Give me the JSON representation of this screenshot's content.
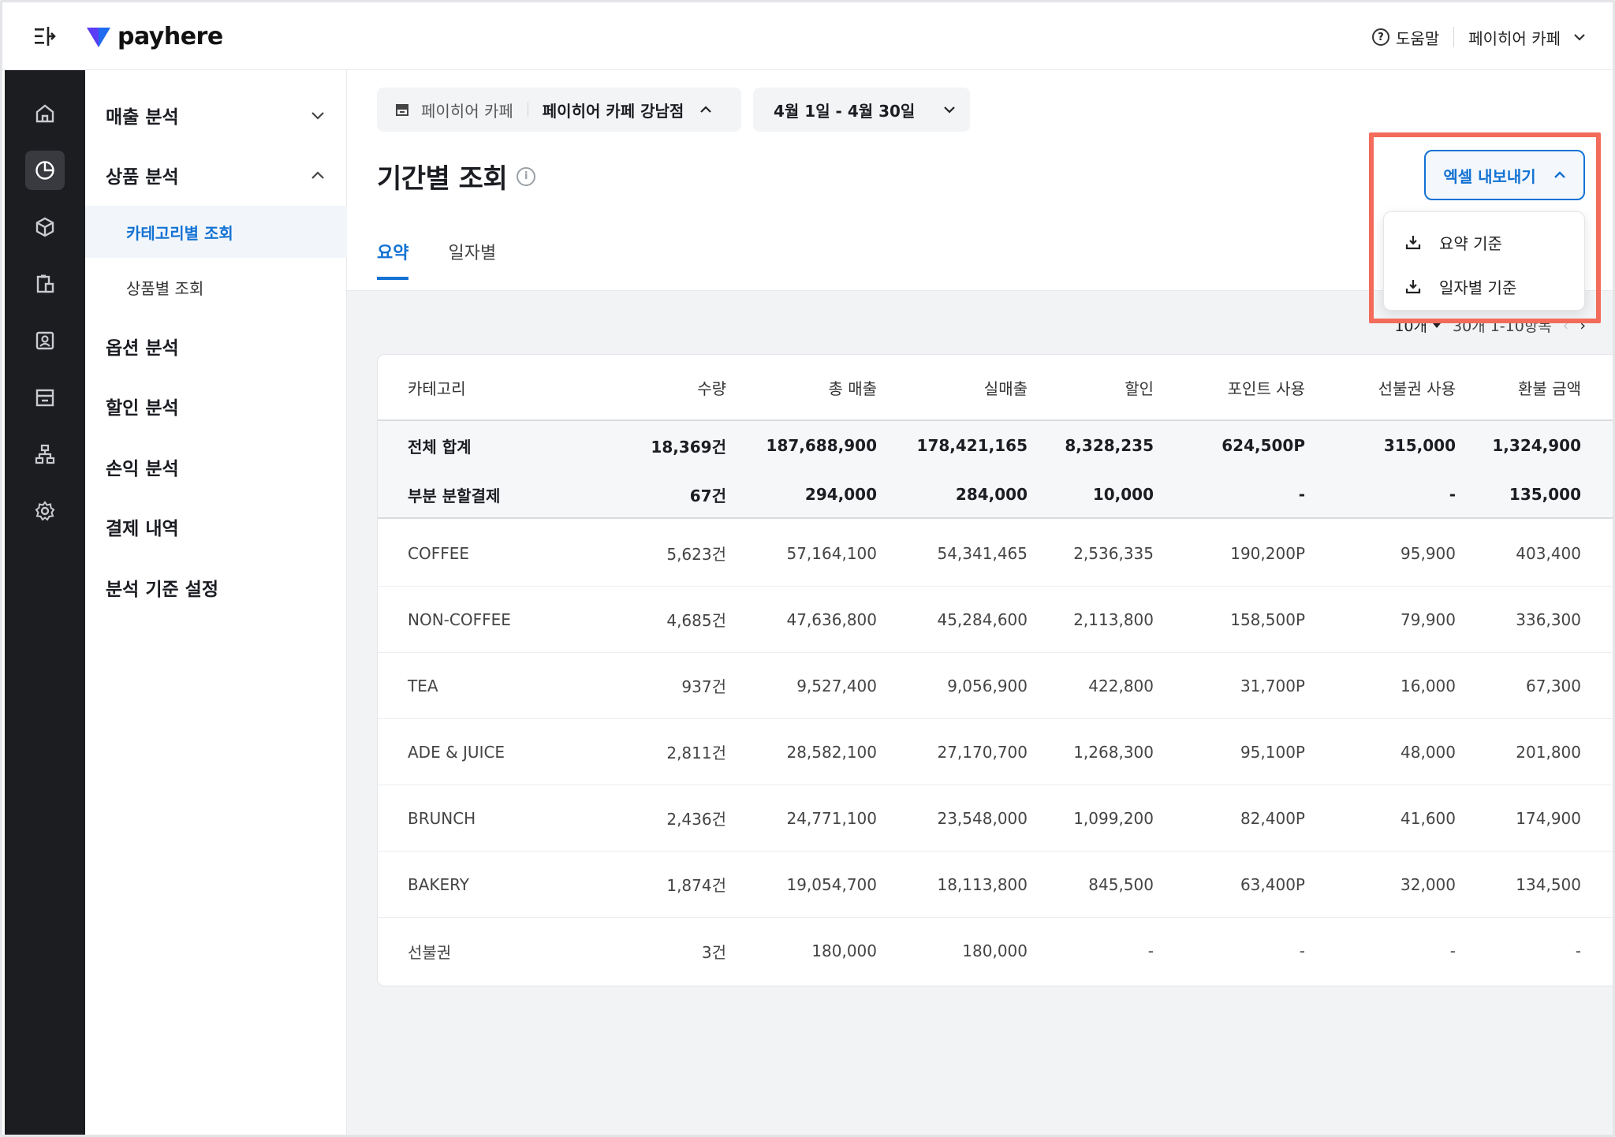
{
  "topbar": {
    "logo_text": "payhere",
    "help_label": "도움말",
    "store_menu_label": "페이히어 카페"
  },
  "subnav": {
    "groups": [
      {
        "label": "매출 분석",
        "expanded": false
      },
      {
        "label": "상품 분석",
        "expanded": true
      },
      {
        "label": "옵션 분석"
      },
      {
        "label": "할인 분석"
      },
      {
        "label": "손익 분석"
      },
      {
        "label": "결제 내역"
      },
      {
        "label": "분석 기준 설정"
      }
    ],
    "sub_items": [
      {
        "label": "카테고리별 조회",
        "active": true
      },
      {
        "label": "상품별 조회",
        "active": false
      }
    ]
  },
  "filters": {
    "brand": "페이히어 카페",
    "branch": "페이히어 카페 강남점",
    "date_range": "4월 1일 - 4월 30일"
  },
  "page": {
    "title": "기간별 조회",
    "tabs": [
      {
        "label": "요약",
        "active": true
      },
      {
        "label": "일자별",
        "active": false
      }
    ]
  },
  "export": {
    "button_label": "엑셀 내보내기",
    "menu_items": [
      "요약 기준",
      "일자별 기준"
    ]
  },
  "pagination": {
    "page_size": "10개",
    "summary": "30개 1-10항목"
  },
  "table": {
    "headers": [
      "카테고리",
      "수량",
      "총 매출",
      "실매출",
      "할인",
      "포인트 사용",
      "선불권 사용",
      "환불 금액"
    ],
    "summary_rows": [
      [
        "전체 합계",
        "18,369건",
        "187,688,900",
        "178,421,165",
        "8,328,235",
        "624,500P",
        "315,000",
        "1,324,900"
      ],
      [
        "부분 분할결제",
        "67건",
        "294,000",
        "284,000",
        "10,000",
        "-",
        "-",
        "135,000"
      ]
    ],
    "rows": [
      [
        "COFFEE",
        "5,623건",
        "57,164,100",
        "54,341,465",
        "2,536,335",
        "190,200P",
        "95,900",
        "403,400"
      ],
      [
        "NON-COFFEE",
        "4,685건",
        "47,636,800",
        "45,284,600",
        "2,113,800",
        "158,500P",
        "79,900",
        "336,300"
      ],
      [
        "TEA",
        "937건",
        "9,527,400",
        "9,056,900",
        "422,800",
        "31,700P",
        "16,000",
        "67,300"
      ],
      [
        "ADE & JUICE",
        "2,811건",
        "28,582,100",
        "27,170,700",
        "1,268,300",
        "95,100P",
        "48,000",
        "201,800"
      ],
      [
        "BRUNCH",
        "2,436건",
        "24,771,100",
        "23,548,000",
        "1,099,200",
        "82,400P",
        "41,600",
        "174,900"
      ],
      [
        "BAKERY",
        "1,874건",
        "19,054,700",
        "18,113,800",
        "845,500",
        "63,400P",
        "32,000",
        "134,500"
      ],
      [
        "선불권",
        "3건",
        "180,000",
        "180,000",
        "-",
        "-",
        "-",
        "-"
      ]
    ]
  },
  "colors": {
    "accent": "#1372d3",
    "highlight": "#f26b5b",
    "rail": "#1c1d21"
  }
}
